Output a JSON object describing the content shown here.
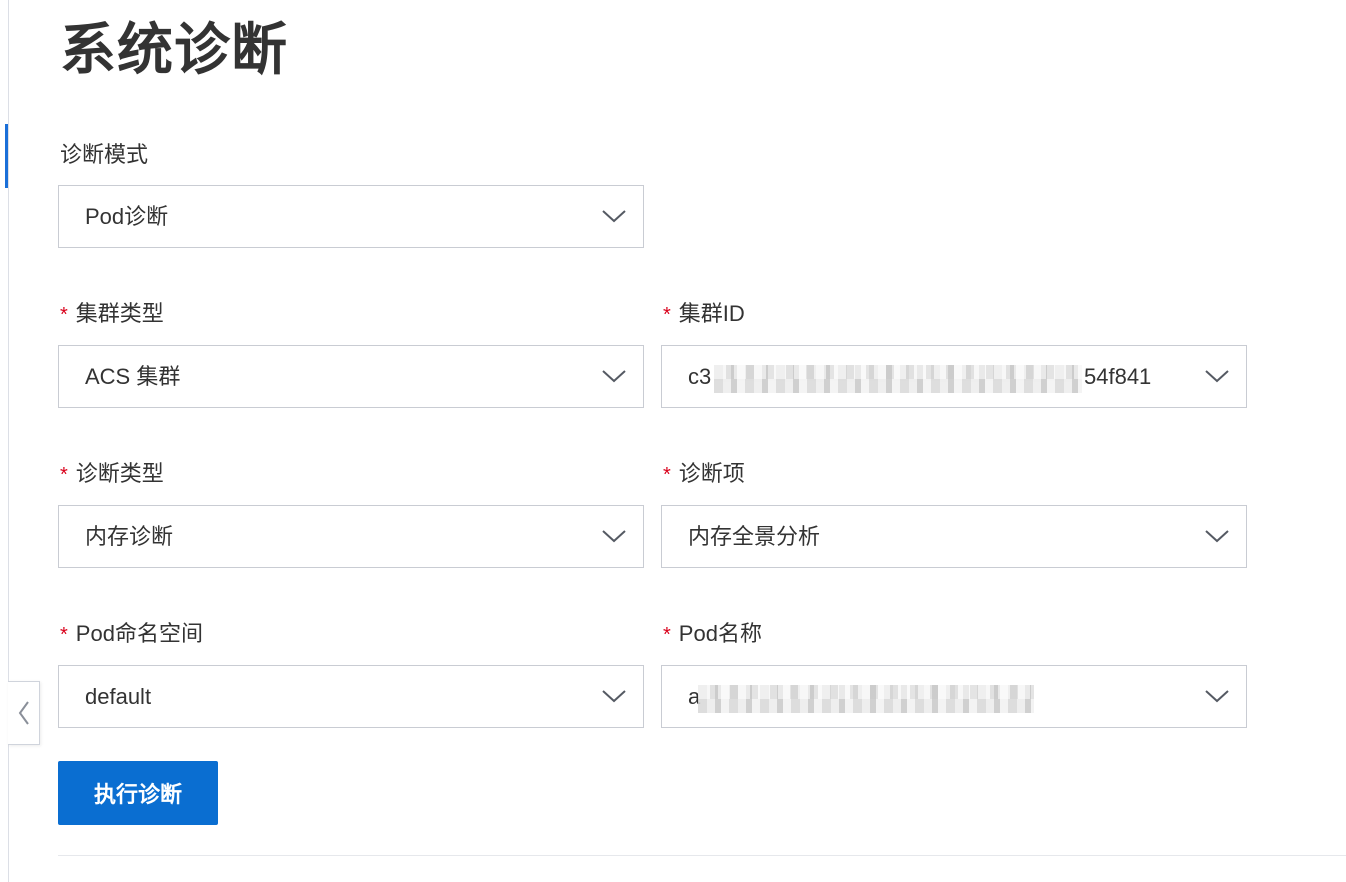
{
  "page": {
    "title": "系统诊断"
  },
  "form": {
    "mode": {
      "label": "诊断模式",
      "value": "Pod诊断"
    },
    "cluster_type": {
      "required_mark": "*",
      "label": "集群类型",
      "value": "ACS 集群"
    },
    "cluster_id": {
      "required_mark": "*",
      "label": "集群ID",
      "value_prefix": "c3",
      "value_suffix": "54f841"
    },
    "diagnosis_type": {
      "required_mark": "*",
      "label": "诊断类型",
      "value": "内存诊断"
    },
    "diagnosis_item": {
      "required_mark": "*",
      "label": "诊断项",
      "value": "内存全景分析"
    },
    "pod_namespace": {
      "required_mark": "*",
      "label": "Pod命名空间",
      "value": "default"
    },
    "pod_name": {
      "required_mark": "*",
      "label": "Pod名称",
      "value_prefix": "a"
    },
    "submit_label": "执行诊断"
  },
  "icons": {
    "dropdown": "chevron-down-icon",
    "collapse": "chevron-left-icon"
  },
  "colors": {
    "primary": "#0a6ed1",
    "required": "#d9001b",
    "rail_indicator": "#1a6fd8"
  }
}
